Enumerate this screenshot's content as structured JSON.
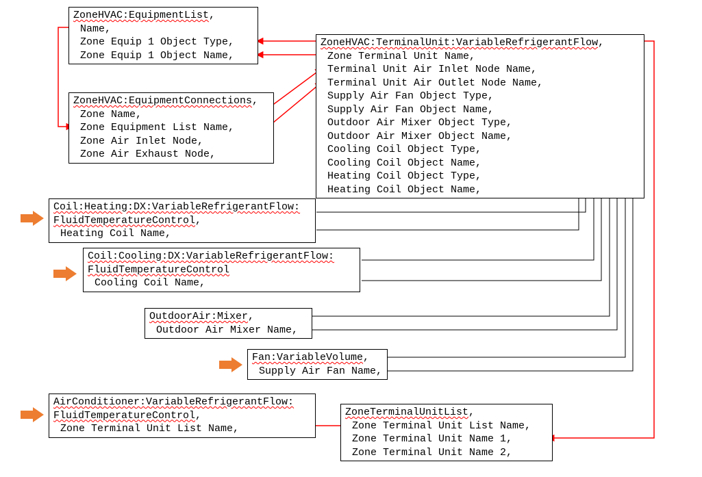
{
  "boxes": {
    "equipList": {
      "title": "ZoneHVAC:EquipmentList",
      "l1": "Name,",
      "l2": "Zone Equip 1 Object Type,",
      "l3": "Zone Equip 1 Object Name,"
    },
    "equipConn": {
      "title": "ZoneHVAC:EquipmentConnections",
      "l1": "Zone Name,",
      "l2": "Zone Equipment List Name,",
      "l3": "Zone Air Inlet Node,",
      "l4": "Zone Air Exhaust Node,"
    },
    "terminalUnit": {
      "title": "ZoneHVAC:TerminalUnit:VariableRefrigerantFlow",
      "l1": "Zone Terminal Unit Name,",
      "l2": "Terminal Unit Air Inlet Node Name,",
      "l3": "Terminal Unit Air Outlet Node Name,",
      "l4": "Supply Air Fan Object Type,",
      "l5": "Supply Air Fan Object Name,",
      "l6": "Outdoor Air Mixer Object Type,",
      "l7": "Outdoor Air Mixer Object Name,",
      "l8": "Cooling Coil Object Type,",
      "l9": "Cooling Coil Object Name,",
      "l10": "Heating Coil Object Type,",
      "l11": "Heating Coil Object Name,"
    },
    "heatCoil": {
      "title1": "Coil:Heating:DX:VariableRefrigerantFlow:",
      "title2": "FluidTemperatureControl",
      "l1": "Heating Coil Name,"
    },
    "coolCoil": {
      "title1": "Coil:Cooling:DX:VariableRefrigerantFlow:",
      "title2": "FluidTemperatureControl",
      "l1": "Cooling Coil Name,"
    },
    "oaMixer": {
      "title": "OutdoorAir:Mixer",
      "l1": "Outdoor Air Mixer Name,"
    },
    "fan": {
      "title": "Fan:VariableVolume",
      "l1": "Supply Air Fan Name,"
    },
    "acVrf": {
      "title1": "AirConditioner:VariableRefrigerantFlow:",
      "title2": "FluidTemperatureControl",
      "l1": "Zone Terminal Unit List Name,"
    },
    "ztuList": {
      "title": "ZoneTerminalUnitList",
      "l1": "Zone Terminal Unit List Name,",
      "l2": "Zone Terminal Unit Name 1,",
      "l3": "Zone Terminal Unit Name 2,"
    }
  }
}
